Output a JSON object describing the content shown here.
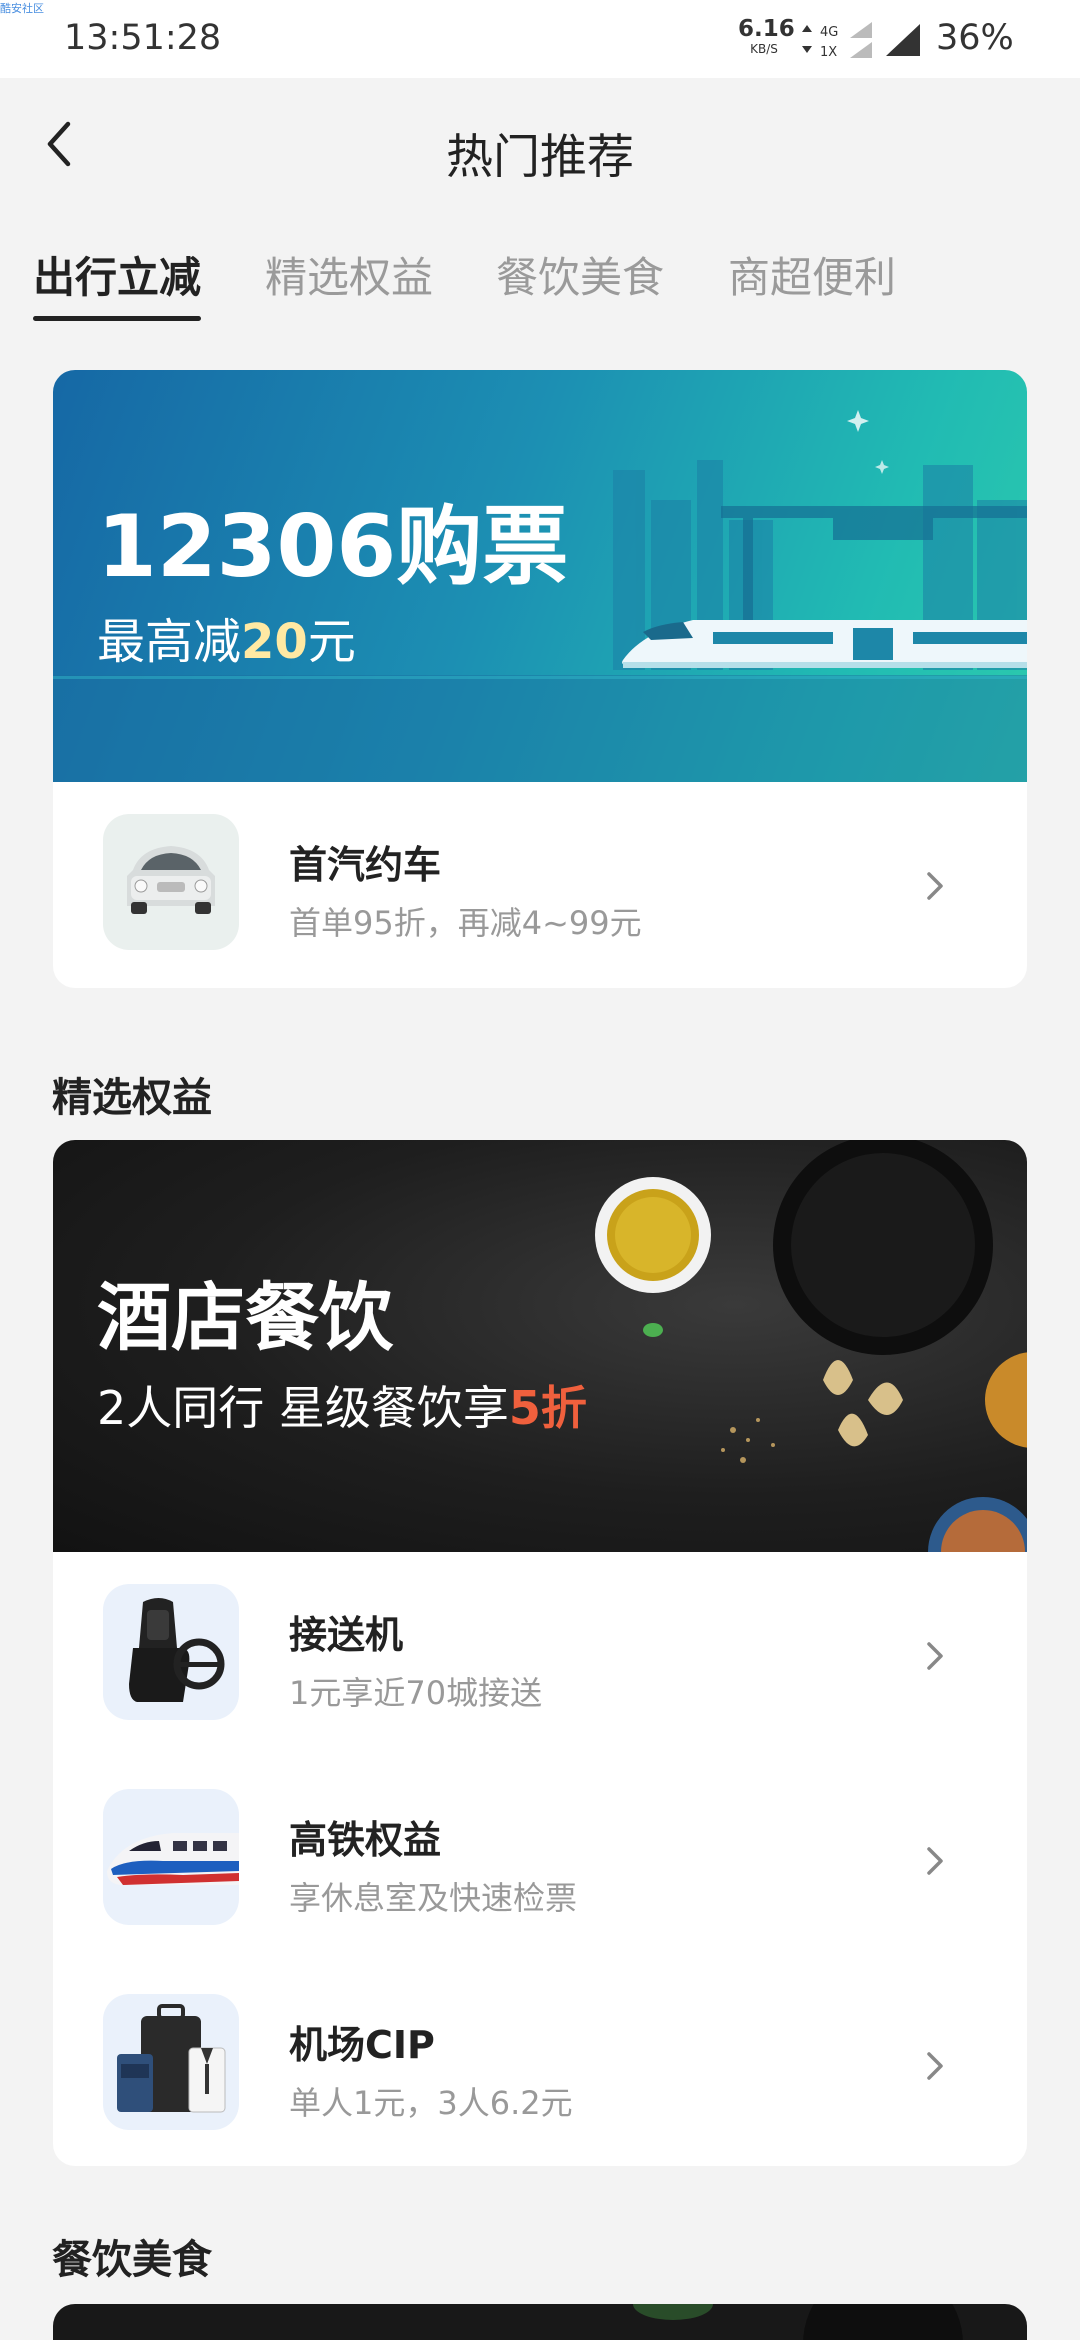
{
  "status": {
    "watermark": "酷安社区",
    "time": "13:51:28",
    "speed_value": "6.16",
    "speed_unit": "KB/S",
    "net_top": "4G",
    "net_bottom": "1X",
    "battery": "36%"
  },
  "header": {
    "title": "热门推荐"
  },
  "tabs": [
    {
      "label": "出行立减",
      "active": true
    },
    {
      "label": "精选权益",
      "active": false
    },
    {
      "label": "餐饮美食",
      "active": false
    },
    {
      "label": "商超便利",
      "active": false
    }
  ],
  "card1": {
    "banner": {
      "title": "12306购票",
      "sub_prefix": "最高减",
      "sub_highlight": "20",
      "sub_suffix": "元"
    },
    "items": [
      {
        "title": "首汽约车",
        "subtitle": "首单95折，再减4~99元",
        "icon": "car-icon"
      }
    ]
  },
  "section2": {
    "title": "精选权益"
  },
  "card2": {
    "banner": {
      "title": "酒店餐饮",
      "sub_prefix": "2人同行 星级餐饮享",
      "sub_highlight": "5折"
    },
    "items": [
      {
        "title": "接送机",
        "subtitle": "1元享近70城接送",
        "icon": "car-seat-icon"
      },
      {
        "title": "高铁权益",
        "subtitle": "享休息室及快速检票",
        "icon": "bullet-train-icon"
      },
      {
        "title": "机场CIP",
        "subtitle": "单人1元，3人6.2元",
        "icon": "luggage-icon"
      }
    ]
  },
  "section3": {
    "title": "餐饮美食"
  },
  "colors": {
    "accent_red": "#f0603d",
    "highlight_yellow": "#ffe9a3",
    "train_banner": "#1c8fb3"
  }
}
